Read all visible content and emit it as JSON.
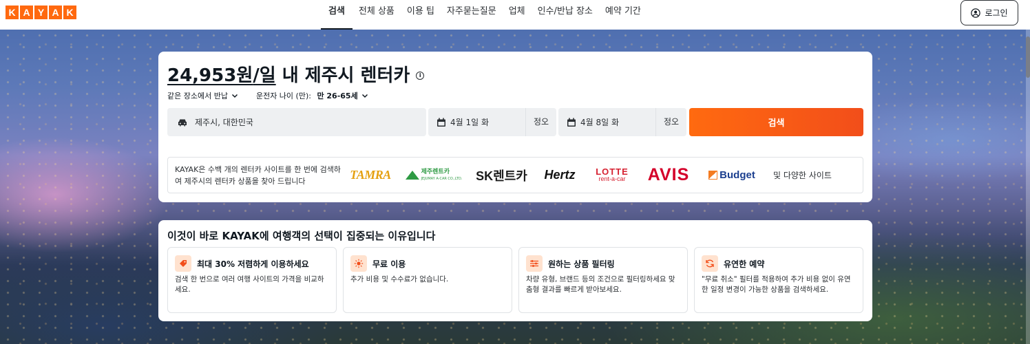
{
  "header": {
    "logo_letters": [
      "K",
      "A",
      "Y",
      "A",
      "K"
    ],
    "nav": [
      {
        "label": "검색",
        "active": true
      },
      {
        "label": "전체 상품"
      },
      {
        "label": "이용 팁"
      },
      {
        "label": "자주묻는질문"
      },
      {
        "label": "업체"
      },
      {
        "label": "인수/반납 장소"
      },
      {
        "label": "예약 기간"
      }
    ],
    "login_label": "로그인"
  },
  "search": {
    "price": "24,953원",
    "per": "/일",
    "title_rest": " 내 제주시 렌터카",
    "info_glyph": "i",
    "return_option": "같은 장소에서 반납",
    "age_label": "운전자 나이 (만): ",
    "age_value": "만 26-65세",
    "location": "제주시, 대한민국",
    "pickup_date": "4월 1일 화",
    "pickup_time": "정오",
    "dropoff_date": "4월 8일 화",
    "dropoff_time": "정오",
    "search_button": "검색",
    "partners_text": "KAYAK은 수백 개의 렌터카 사이트를 한 번에 검색하여 제주시의 렌터카 상품을 찾아 드립니다",
    "partner_logos": {
      "tamra": "TAMRA",
      "jeju": "제주렌트카",
      "jeju_sub": "JEJUMAY A-CAR CO.,LTD.",
      "sk": "SK렌트카",
      "hertz": "Hertz",
      "lotte_a": "LOTTE",
      "lotte_b": "rent-a-car",
      "avis": "AVIS",
      "budget": "Budget"
    },
    "more_sites": "및 다양한 사이트"
  },
  "why": {
    "title": "이것이 바로 KAYAK에 여행객의 선택이 집중되는 이유입니다",
    "features": [
      {
        "icon": "percent-tag-icon",
        "title": "최대 30% 저렴하게 이용하세요",
        "desc": "검색 한 번으로 여러 여행 사이트의 가격을 비교하세요."
      },
      {
        "icon": "sun-icon",
        "title": "무료 이용",
        "desc": "추가 비용 및 수수료가 없습니다."
      },
      {
        "icon": "sliders-icon",
        "title": "원하는 상품 필터링",
        "desc": "차량 유형, 브랜드 등의 조건으로 필터링하세요 맞춤형 결과를 빠르게 받아보세요."
      },
      {
        "icon": "refresh-icon",
        "title": "유연한 예약",
        "desc": "\"무료 취소\" 필터를 적용하여 추가 비용 없이 유연한 일정 변경이 가능한 상품을 검색하세요."
      }
    ]
  },
  "colors": {
    "accent": "#ff690f",
    "button_gradient_end": "#f24e1a"
  }
}
